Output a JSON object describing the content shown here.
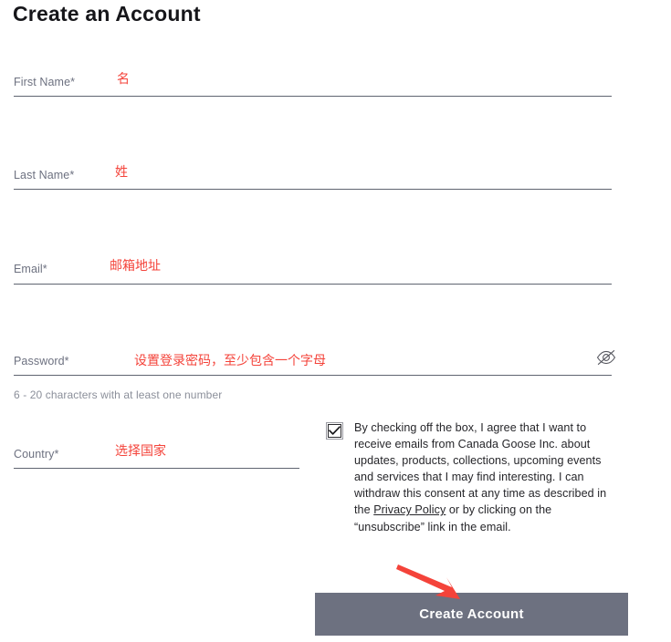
{
  "page": {
    "title": "Create an Account"
  },
  "colors": {
    "annotation_red": "#f4433a",
    "label_gray": "#6d7180",
    "button_bg": "#6d7180",
    "rule": "#5f6470",
    "helper_gray": "#8b8f9a"
  },
  "fields": [
    {
      "key": "first_name",
      "label": "First Name*",
      "value": "",
      "annotation": "名",
      "rule": "full"
    },
    {
      "key": "last_name",
      "label": "Last Name*",
      "value": "",
      "annotation": "姓",
      "rule": "full"
    },
    {
      "key": "email",
      "label": "Email*",
      "value": "",
      "annotation": "邮箱地址",
      "rule": "full"
    },
    {
      "key": "password",
      "label": "Password*",
      "value": "",
      "annotation": "设置登录密码，至少包含一个字母",
      "rule": "full",
      "helper": "6 - 20 characters with at least one number",
      "toggle_icon": "eye-slash-icon"
    },
    {
      "key": "country",
      "label": "Country*",
      "value": "",
      "annotation": "选择国家",
      "rule": "half"
    }
  ],
  "consent": {
    "checked": true,
    "checkbox_icon": "checkmark-icon",
    "text_before_link": "By checking off the box, I agree that I want to receive emails from Canada Goose Inc. about updates, products, collections, upcoming events and services that I may find interesting. I can withdraw this consent at any time as described in the ",
    "link_label": "Privacy Policy",
    "text_after_link": " or by clicking on the “unsubscribe” link in the email."
  },
  "submit": {
    "label": "Create Account"
  },
  "pointer": {
    "icon": "red-arrow-icon"
  }
}
